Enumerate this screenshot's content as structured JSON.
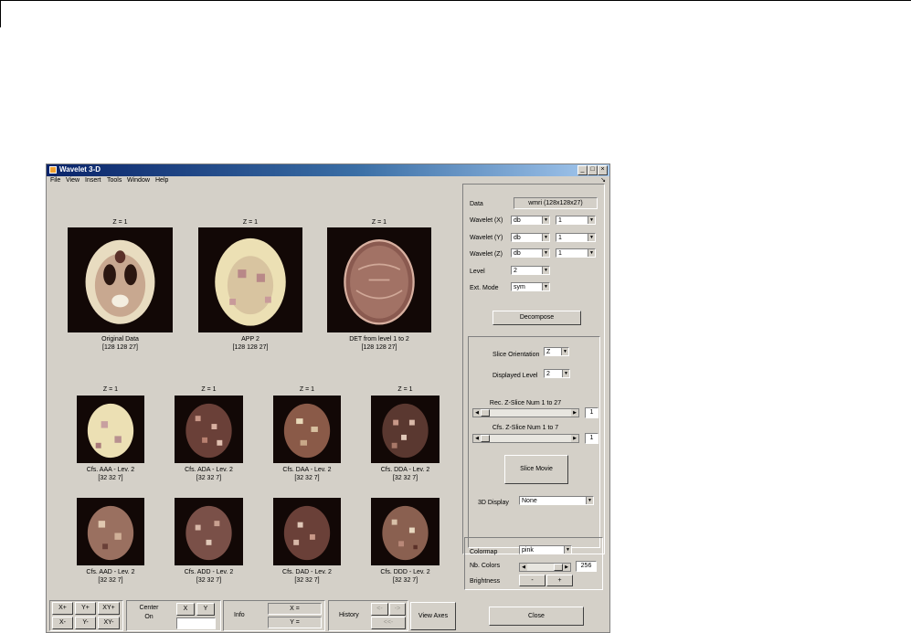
{
  "window": {
    "title": "Wavelet 3-D",
    "controls": [
      "_",
      "□",
      "×"
    ]
  },
  "menu": [
    "File",
    "View",
    "Insert",
    "Tools",
    "Window",
    "Help"
  ],
  "top_images": [
    {
      "z_label": "Z = 1",
      "caption": "Original Data",
      "dims": "[128  128   27]"
    },
    {
      "z_label": "Z = 1",
      "caption": "APP 2",
      "dims": "[128  128   27]"
    },
    {
      "z_label": "Z = 1",
      "caption": "DET from level 1 to 2",
      "dims": "[128  128   27]"
    }
  ],
  "row2_images": [
    {
      "z_label": "Z = 1",
      "caption": "Cfs. AAA - Lev. 2",
      "dims": "[32   32    7]"
    },
    {
      "z_label": "Z = 1",
      "caption": "Cfs. ADA - Lev. 2",
      "dims": "[32   32    7]"
    },
    {
      "z_label": "Z = 1",
      "caption": "Cfs. DAA - Lev. 2",
      "dims": "[32   32    7]"
    },
    {
      "z_label": "Z = 1",
      "caption": "Cfs. DDA - Lev. 2",
      "dims": "[32   32    7]"
    }
  ],
  "row3_images": [
    {
      "caption": "Cfs. AAD - Lev. 2",
      "dims": "[32   32    7]"
    },
    {
      "caption": "Cfs. ADD - Lev. 2",
      "dims": "[32   32    7]"
    },
    {
      "caption": "Cfs. DAD - Lev. 2",
      "dims": "[32   32    7]"
    },
    {
      "caption": "Cfs. DDD - Lev. 2",
      "dims": "[32   32    7]"
    }
  ],
  "controls": {
    "data_label": "Data",
    "data_value": "wmri  (128x128x27)",
    "wavelet_x_label": "Wavelet (X)",
    "wavelet_x_family": "db",
    "wavelet_x_num": "1",
    "wavelet_y_label": "Wavelet (Y)",
    "wavelet_y_family": "db",
    "wavelet_y_num": "1",
    "wavelet_z_label": "Wavelet (Z)",
    "wavelet_z_family": "db",
    "wavelet_z_num": "1",
    "level_label": "Level",
    "level_value": "2",
    "ext_mode_label": "Ext. Mode",
    "ext_mode_value": "sym",
    "decompose_label": "Decompose",
    "slice_orientation_label": "Slice Orientation",
    "slice_orientation_value": "Z",
    "displayed_level_label": "Displayed Level",
    "displayed_level_value": "2",
    "rec_slice_label": "Rec. Z-Slice Num 1 to 27",
    "rec_slice_value": "1",
    "cfs_slice_label": "Cfs. Z-Slice Num 1 to 7",
    "cfs_slice_value": "1",
    "slice_movie_label": "Slice Movie",
    "display3d_label": "3D Display",
    "display3d_value": "None",
    "colormap_label": "Colormap",
    "colormap_value": "pink",
    "nb_colors_label": "Nb. Colors",
    "nb_colors_value": "256",
    "brightness_label": "Brightness",
    "brightness_minus": "-",
    "brightness_plus": "+",
    "close_label": "Close"
  },
  "bottom": {
    "xplus": "X+",
    "yplus": "Y+",
    "xyplus": "XY+",
    "xminus": "X-",
    "yminus": "Y-",
    "xyminus": "XY-",
    "center_label": "Center",
    "center_state": "On",
    "center_x": "X",
    "center_y": "Y",
    "info_label": "Info",
    "info_x": "X =",
    "info_y": "Y =",
    "history_label": "History",
    "history_back": "<-",
    "history_fwd": "->",
    "history_all": "<<-",
    "view_axes_label": "View Axes"
  }
}
